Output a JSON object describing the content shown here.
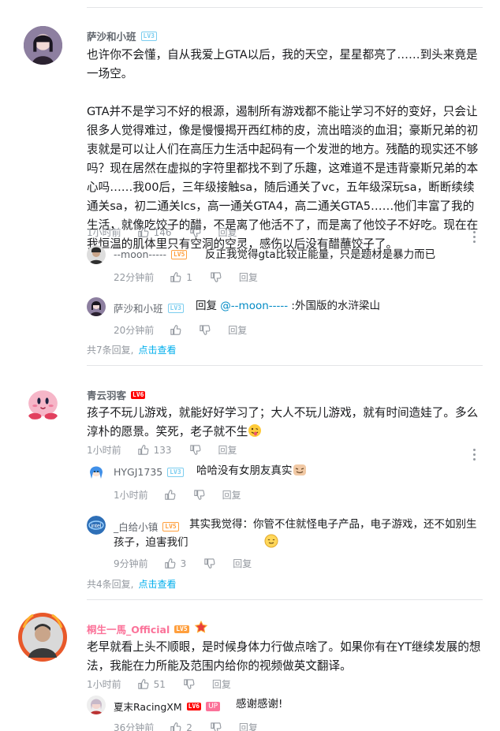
{
  "comments": [
    {
      "user": "萨沙和小班",
      "level": "LV3",
      "text": "也许你不会懂，自从我爱上GTA以后，我的天空，星星都亮了……到头来竟是一场空。\n\nGTA并不是学习不好的根源，遏制所有游戏都不能让学习不好的变好，只会让很多人觉得难过，像是慢慢揭开西红柿的皮，流出暗淡的血泪；豪斯兄弟的初衷就是可以让人们在高压力生活中起码有一个发泄的地方。残酷的现实还不够吗？现在居然在虚拟的字符里都找不到了乐趣，这难道不是违背豪斯兄弟的本心吗……我00后，三年级接触sa，随后通关了vc，五年级深玩sa，断断续续通关sa，初二通关lcs，高一通关GTA4，高二通关GTA5……他们丰富了我的生活，就像吃饺子的醋，不是离了他活不了，而是离了他饺子不好吃。现在在我恒温的肌体里只有空洞的空灵，感伤以后没有醋蘸饺子了。",
      "time": "1小时前",
      "likes": "146",
      "reply_label": "回复",
      "replies": [
        {
          "user": "--moon-----",
          "level": "LV5",
          "text": "反正我觉得gta比较正能量，只是题材是暴力而已",
          "time": "22分钟前",
          "likes": "1",
          "reply_label": "回复"
        },
        {
          "user": "萨沙和小班",
          "level": "LV3",
          "prefix": "回复 ",
          "mention": "@--moon-----",
          "text": " :外国版的水浒梁山",
          "time": "20分钟前",
          "likes": "",
          "reply_label": "回复"
        }
      ],
      "more_count": "共7条回复,",
      "more_link": "点击查看"
    },
    {
      "user": "青云羽客",
      "level": "LV6",
      "text": "孩子不玩儿游戏，就能好好学习了；大人不玩儿游戏，就有时间造娃了。多么淳朴的愿景。笑死，老子就不生",
      "time": "1小时前",
      "likes": "133",
      "reply_label": "回复",
      "replies": [
        {
          "user": "HYGJ1735",
          "level": "LV3",
          "text": "哈哈没有女朋友真实",
          "time": "1小时前",
          "likes": "",
          "reply_label": "回复"
        },
        {
          "user": "_白给小镇",
          "level": "LV5",
          "text": "其实我觉得：你管不住就怪电子产品，电子游戏，还不如别生孩子，迫害我们",
          "time": "9分钟前",
          "likes": "3",
          "reply_label": "回复"
        }
      ],
      "more_count": "共4条回复,",
      "more_link": "点击查看"
    },
    {
      "user": "桐生一馬_Official",
      "level": "LV5",
      "text": "老早就看上头不顺眼，是时候身体力行做点啥了。如果你有在YT继续发展的想法，我能在力所能及范围内给你的视频做英文翻译。",
      "time": "1小时前",
      "likes": "51",
      "reply_label": "回复",
      "replies": [
        {
          "user": "夏末RacingXM",
          "level": "LV6",
          "badge": "UP",
          "text": "感谢感谢!",
          "time": "36分钟前",
          "likes": "2",
          "reply_label": "回复"
        }
      ]
    }
  ],
  "icons": {
    "like": "thumbs-up-icon",
    "dislike": "thumbs-down-icon",
    "more": "more-vertical-icon"
  }
}
